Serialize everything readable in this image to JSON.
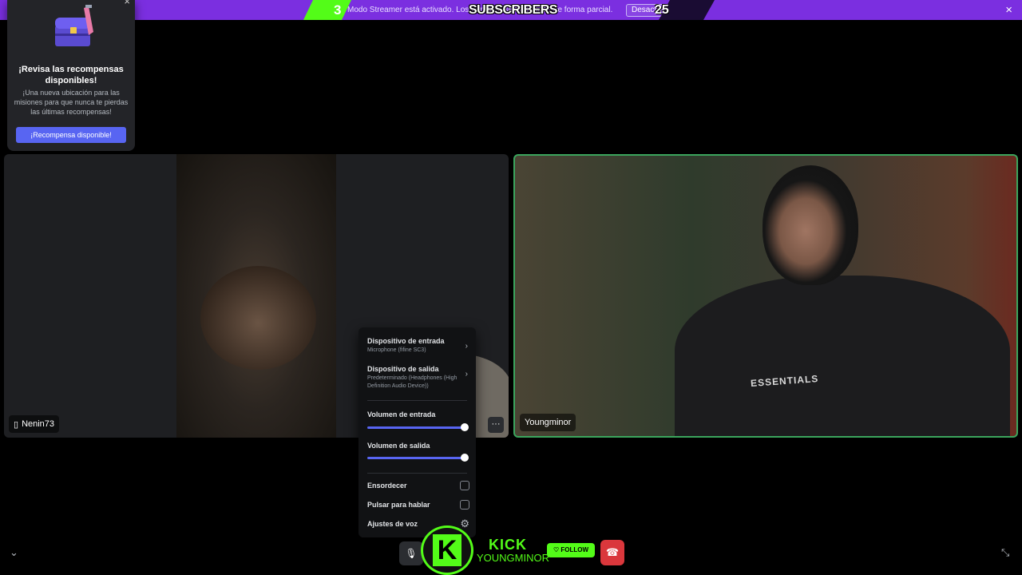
{
  "banner": {
    "text": "Modo Streamer está activado. Los nombres se mostrarán de forma parcial.",
    "button_label": "Desactivar",
    "close_icon": "×"
  },
  "overlay": {
    "subs_number": "3",
    "subs_label": "SUBSCRIBERS",
    "subs_count": "25"
  },
  "reward": {
    "title": "¡Revisa las recompensas disponibles!",
    "description": "¡Una nueva ubicación para las misiones para que nunca te pierdas las últimas recompensas!",
    "button_label": "¡Recompensa disponible!",
    "close_icon": "×"
  },
  "tiles": {
    "left_name": "Nenin73",
    "left_device_icon": "phone-icon",
    "right_name": "Youngminor",
    "hoodie_text": "ESSENTIALS",
    "more_icon": "···"
  },
  "audio_menu": {
    "input_device_label": "Dispositivo de entrada",
    "input_device_value": "Microphone (fifine SC3)",
    "output_device_label": "Dispositivo de salida",
    "output_device_value": "Predeterminado (Headphones (High Definition Audio Device))",
    "input_volume_label": "Volumen de entrada",
    "output_volume_label": "Volumen de salida",
    "input_volume": 1.0,
    "output_volume": 1.0,
    "deafen_label": "Ensordecer",
    "push_to_talk_label": "Pulsar para hablar",
    "voice_settings_label": "Ajustes de voz"
  },
  "kick": {
    "logo_letter": "K",
    "word": "KICK",
    "username": "YOUNGMINOR",
    "follow_label": "FOLLOW"
  },
  "colors": {
    "accent": "#5865f2",
    "streamer_banner": "#7b2fe0",
    "kick_green": "#53fc18",
    "speaking_border": "#3ba55d",
    "hangup": "#da373c"
  }
}
